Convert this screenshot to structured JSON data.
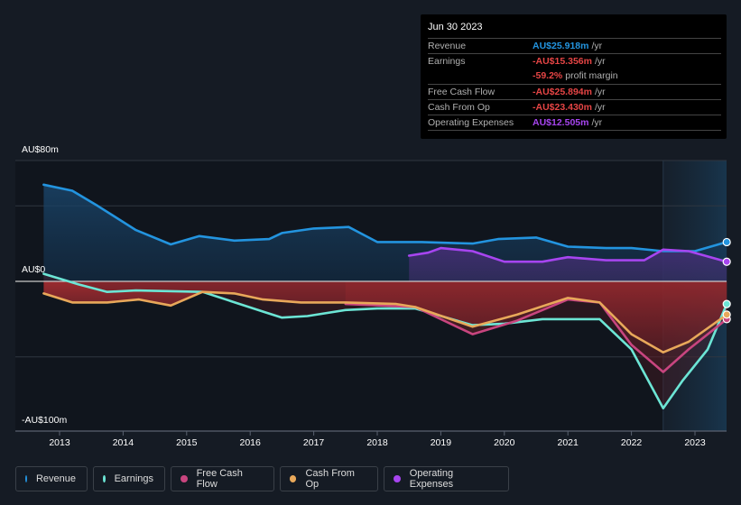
{
  "tooltip": {
    "date": "Jun 30 2023",
    "rows": [
      {
        "label": "Revenue",
        "value": "AU$25.918m",
        "unit": "/yr",
        "color": "#2394df"
      },
      {
        "label": "Earnings",
        "value": "-AU$15.356m",
        "unit": "/yr",
        "color": "#e64545"
      },
      {
        "label": "",
        "value": "-59.2%",
        "unit": "profit margin",
        "color": "#e64545"
      },
      {
        "label": "Free Cash Flow",
        "value": "-AU$25.894m",
        "unit": "/yr",
        "color": "#e64545"
      },
      {
        "label": "Cash From Op",
        "value": "-AU$23.430m",
        "unit": "/yr",
        "color": "#e64545"
      },
      {
        "label": "Operating Expenses",
        "value": "AU$12.505m",
        "unit": "/yr",
        "color": "#a745f0"
      }
    ]
  },
  "legend": [
    {
      "label": "Revenue",
      "color": "#2394df"
    },
    {
      "label": "Earnings",
      "color": "#6ce5d5"
    },
    {
      "label": "Free Cash Flow",
      "color": "#c8457f"
    },
    {
      "label": "Cash From Op",
      "color": "#e8a85a"
    },
    {
      "label": "Operating Expenses",
      "color": "#a745f0"
    }
  ],
  "chart_data": {
    "type": "line",
    "title": "",
    "xlabel": "",
    "ylabel": "",
    "y_tick_labels": [
      "AU$80m",
      "AU$0",
      "-AU$100m"
    ],
    "ylim": [
      -100,
      80
    ],
    "xlim": [
      2012.4,
      2023.5
    ],
    "x_ticks": [
      "2013",
      "2014",
      "2015",
      "2016",
      "2017",
      "2018",
      "2019",
      "2020",
      "2021",
      "2022",
      "2023"
    ],
    "units": "AU$m",
    "highlight_start": 2022.5,
    "legend_position": "bottom",
    "series": [
      {
        "name": "Revenue",
        "color": "#2394df",
        "x": [
          2012.75,
          2013.2,
          2013.6,
          2014.2,
          2014.75,
          2015.2,
          2015.75,
          2016.3,
          2016.5,
          2017.0,
          2017.55,
          2018.0,
          2018.7,
          2019.5,
          2019.9,
          2020.5,
          2021.0,
          2021.6,
          2022.0,
          2022.5,
          2023.0,
          2023.5
        ],
        "values": [
          64,
          60,
          50,
          34,
          24.5,
          30,
          27,
          28,
          32,
          35,
          36,
          26,
          26,
          25,
          28,
          29,
          23,
          22,
          22,
          20,
          20,
          26
        ]
      },
      {
        "name": "Earnings",
        "color": "#6ce5d5",
        "x": [
          2012.75,
          2013.3,
          2013.75,
          2014.2,
          2015.25,
          2016.2,
          2016.5,
          2016.9,
          2017.5,
          2018.0,
          2018.6,
          2019.5,
          2020.0,
          2020.6,
          2021.5,
          2022.0,
          2022.5,
          2022.8,
          2023.2,
          2023.5
        ],
        "values": [
          5,
          -2,
          -7,
          -6,
          -7,
          -20,
          -24,
          -23,
          -19,
          -18,
          -18,
          -29,
          -28,
          -25,
          -25,
          -45,
          -84,
          -66,
          -45,
          -15
        ]
      },
      {
        "name": "Free Cash Flow",
        "color": "#c8457f",
        "x": [
          2017.5,
          2018.6,
          2019.5,
          2020.2,
          2021.0,
          2021.5,
          2022.0,
          2022.5,
          2022.9,
          2023.5
        ],
        "values": [
          -15,
          -17,
          -35,
          -26,
          -12,
          -14,
          -42,
          -60,
          -45,
          -25
        ]
      },
      {
        "name": "Cash From Op",
        "color": "#e8a85a",
        "x": [
          2012.75,
          2013.2,
          2013.75,
          2014.25,
          2014.75,
          2015.25,
          2015.75,
          2016.2,
          2016.8,
          2017.5,
          2018.3,
          2018.6,
          2019.5,
          2020.2,
          2021.0,
          2021.5,
          2022.0,
          2022.5,
          2022.9,
          2023.5
        ],
        "values": [
          -8,
          -14,
          -14,
          -12,
          -16,
          -7,
          -8,
          -12,
          -14,
          -14,
          -15,
          -17,
          -30,
          -22,
          -11,
          -14,
          -35,
          -47,
          -40,
          -22
        ]
      },
      {
        "name": "Operating Expenses",
        "color": "#a745f0",
        "x": [
          2018.5,
          2018.8,
          2019.0,
          2019.5,
          2020.0,
          2020.6,
          2021.0,
          2021.6,
          2022.2,
          2022.5,
          2022.9,
          2023.5
        ],
        "values": [
          17,
          19,
          22,
          20,
          13,
          13,
          16,
          14,
          14,
          21,
          20,
          13
        ]
      }
    ]
  }
}
